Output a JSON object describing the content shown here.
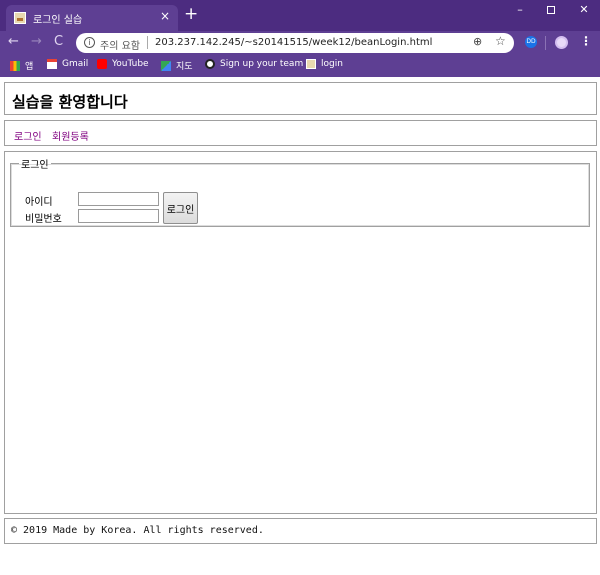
{
  "browser": {
    "tab_title": "로그인 실습",
    "tab_close": "×",
    "new_tab": "+",
    "window_controls": {
      "minimize": "–",
      "close": "✕"
    },
    "nav": {
      "back": "←",
      "forward": "→",
      "reload": "C"
    },
    "address_bar": {
      "security_label": "주의 요함",
      "url": "203.237.142.245/~s20141515/week12/beanLogin.html"
    },
    "extension_label": "DD",
    "menu": "⋮",
    "bookmarks": [
      {
        "label": "앱",
        "icon": "apps-icon"
      },
      {
        "label": "Gmail",
        "icon": "gmail-icon"
      },
      {
        "label": "YouTube",
        "icon": "youtube-icon"
      },
      {
        "label": "지도",
        "icon": "maps-icon"
      },
      {
        "label": "Sign up your team",
        "icon": "github-icon"
      },
      {
        "label": "login",
        "icon": "page-icon"
      }
    ]
  },
  "page": {
    "heading": "실습을 환영합니다",
    "nav_links": {
      "login": "로그인",
      "register": "회원등록"
    },
    "login_form": {
      "legend": "로그인",
      "id_label": "아이디",
      "password_label": "비밀번호",
      "submit_label": "로그인",
      "id_value": "",
      "password_value": ""
    },
    "footer": "© 2019 Made by Korea. All rights reserved."
  }
}
